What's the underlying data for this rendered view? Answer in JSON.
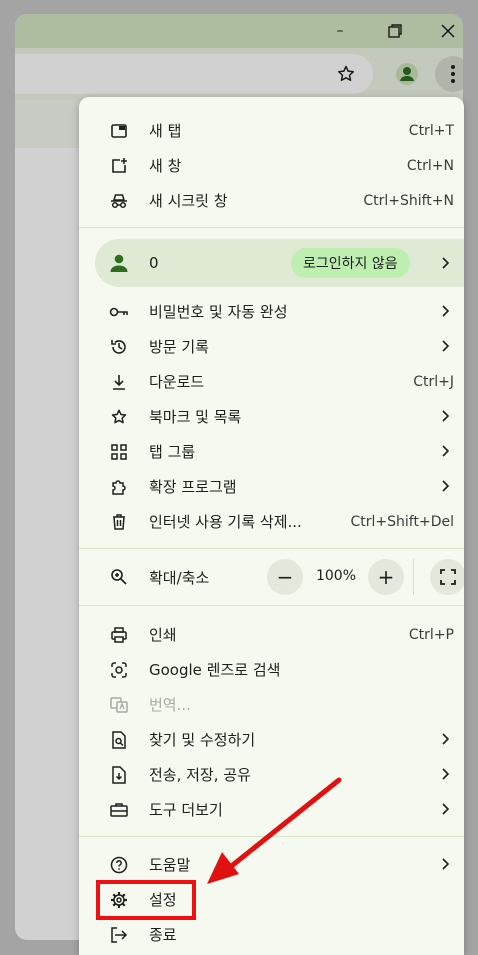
{
  "browser": {
    "window_controls": {
      "minimize": "–",
      "maximize": "❐",
      "close": "✕"
    }
  },
  "menu": {
    "group1": [
      {
        "name": "new-tab",
        "icon": "new-tab-icon",
        "label": "새 탭",
        "shortcut": "Ctrl+T"
      },
      {
        "name": "new-window",
        "icon": "new-window-icon",
        "label": "새 창",
        "shortcut": "Ctrl+N"
      },
      {
        "name": "new-incognito-window",
        "icon": "incognito-icon",
        "label": "새 시크릿 창",
        "shortcut": "Ctrl+Shift+N"
      }
    ],
    "profile": {
      "name": "0",
      "status": "로그인하지 않음"
    },
    "group2": [
      {
        "name": "passwords-autofill",
        "icon": "key-icon",
        "label": "비밀번호 및 자동 완성",
        "submenu": true
      },
      {
        "name": "history",
        "icon": "history-icon",
        "label": "방문 기록",
        "submenu": true
      },
      {
        "name": "downloads",
        "icon": "download-icon",
        "label": "다운로드",
        "shortcut": "Ctrl+J"
      },
      {
        "name": "bookmarks-lists",
        "icon": "star-icon",
        "label": "북마크 및 목록",
        "submenu": true
      },
      {
        "name": "tab-groups",
        "icon": "grid-icon",
        "label": "탭 그룹",
        "submenu": true
      },
      {
        "name": "extensions",
        "icon": "puzzle-icon",
        "label": "확장 프로그램",
        "submenu": true
      },
      {
        "name": "delete-browsing-data",
        "icon": "trash-icon",
        "label": "인터넷 사용 기록 삭제...",
        "shortcut": "Ctrl+Shift+Del"
      }
    ],
    "zoom": {
      "label": "확대/축소",
      "minus": "−",
      "value": "100%",
      "plus": "+"
    },
    "group3": [
      {
        "name": "print",
        "icon": "printer-icon",
        "label": "인쇄",
        "shortcut": "Ctrl+P"
      },
      {
        "name": "google-lens",
        "icon": "lens-icon",
        "label": "Google 렌즈로 검색"
      },
      {
        "name": "translate",
        "icon": "translate-icon",
        "label": "번역...",
        "disabled": true
      },
      {
        "name": "find-edit",
        "icon": "find-page-icon",
        "label": "찾기 및 수정하기",
        "submenu": true
      },
      {
        "name": "cast-save-share",
        "icon": "save-share-icon",
        "label": "전송, 저장, 공유",
        "submenu": true
      },
      {
        "name": "more-tools",
        "icon": "toolbox-icon",
        "label": "도구 더보기",
        "submenu": true
      }
    ],
    "group4": [
      {
        "name": "help",
        "icon": "help-icon",
        "label": "도움말",
        "submenu": true
      },
      {
        "name": "settings",
        "icon": "gear-icon",
        "label": "설정"
      },
      {
        "name": "exit",
        "icon": "exit-icon",
        "label": "종료"
      }
    ]
  },
  "colors": {
    "accent": "#2f6d22",
    "highlight": "#e11111",
    "menu_bg": "#f5f9ef",
    "chip": "#bfefb0"
  }
}
